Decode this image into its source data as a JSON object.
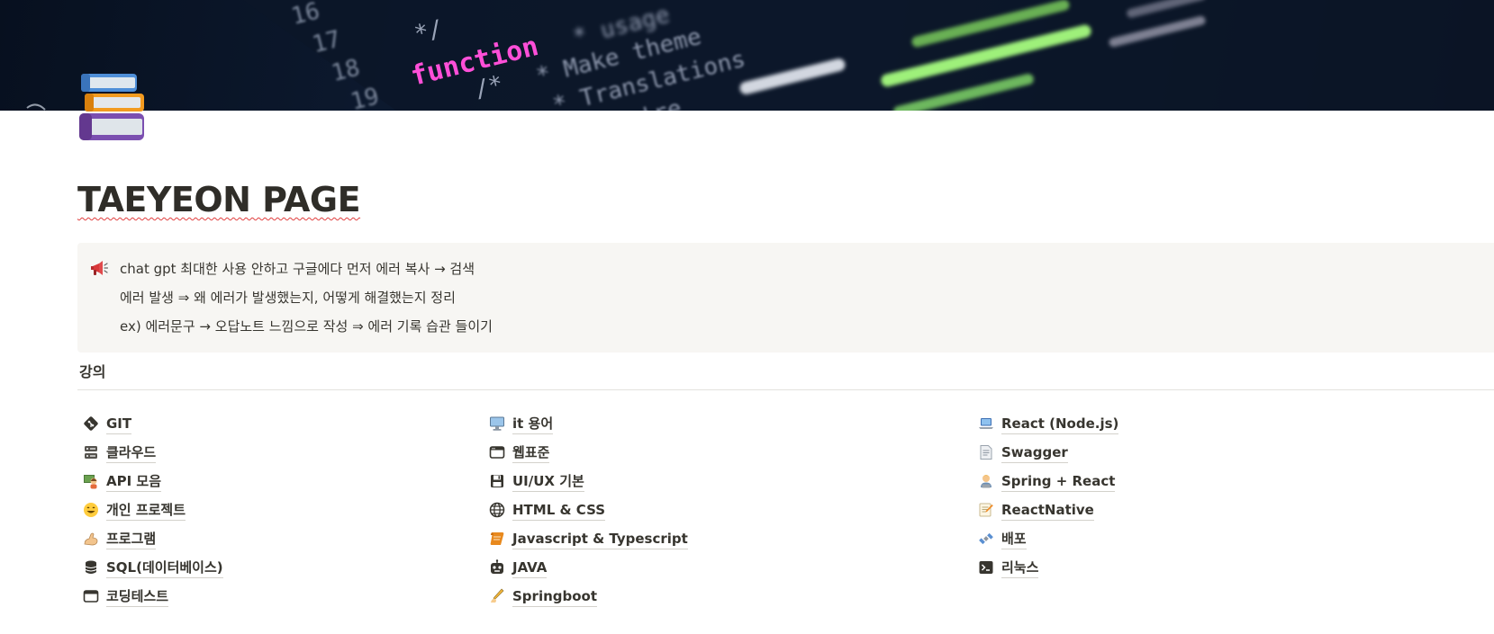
{
  "cover": {
    "code_lines": [
      "16",
      "17",
      "18",
      "19"
    ],
    "code_words": [
      "*/",
      "function",
      "/*",
      "* Make theme",
      "* Translations",
      "* you're",
      "* usage"
    ]
  },
  "page": {
    "title": "TAEYEON PAGE",
    "icon": "books-icon"
  },
  "callout": {
    "icon": "megaphone-icon",
    "lines": [
      "chat gpt 최대한 사용 안하고 구글에다 먼저 에러 복사 → 검색",
      "에러 발생 ⇒ 왜 에러가 발생했는지, 어떻게 해결했는지 정리",
      "ex) 에러문구 → 오답노트 느낌으로 작성 ⇒ 에러 기록 습관 들이기"
    ]
  },
  "section": {
    "heading": "강의"
  },
  "columns": [
    [
      {
        "label": "GIT",
        "icon": "git-icon"
      },
      {
        "label": "클라우드",
        "icon": "server-icon"
      },
      {
        "label": "API 모음",
        "icon": "teacher-icon"
      },
      {
        "label": "개인 프로젝트",
        "icon": "smile-icon"
      },
      {
        "label": "프로그램",
        "icon": "flexed-arm-icon"
      },
      {
        "label": "SQL(데이터베이스)",
        "icon": "database-icon"
      },
      {
        "label": "코딩테스트",
        "icon": "browser-window-icon"
      }
    ],
    [
      {
        "label": "it 용어",
        "icon": "desktop-computer-icon"
      },
      {
        "label": "웹표준",
        "icon": "window-icon"
      },
      {
        "label": "UI/UX 기본",
        "icon": "floppy-disk-icon"
      },
      {
        "label": "HTML & CSS",
        "icon": "globe-icon"
      },
      {
        "label": "Javascript & Typescript",
        "icon": "scroll-icon"
      },
      {
        "label": "JAVA",
        "icon": "robot-icon"
      },
      {
        "label": "Springboot",
        "icon": "writing-hand-icon"
      }
    ],
    [
      {
        "label": "React (Node.js)",
        "icon": "laptop-icon"
      },
      {
        "label": "Swagger",
        "icon": "document-icon"
      },
      {
        "label": "Spring + React",
        "icon": "technologist-icon"
      },
      {
        "label": "ReactNative",
        "icon": "memo-icon"
      },
      {
        "label": "배포",
        "icon": "satellite-icon"
      },
      {
        "label": "리눅스",
        "icon": "terminal-icon"
      }
    ]
  ]
}
